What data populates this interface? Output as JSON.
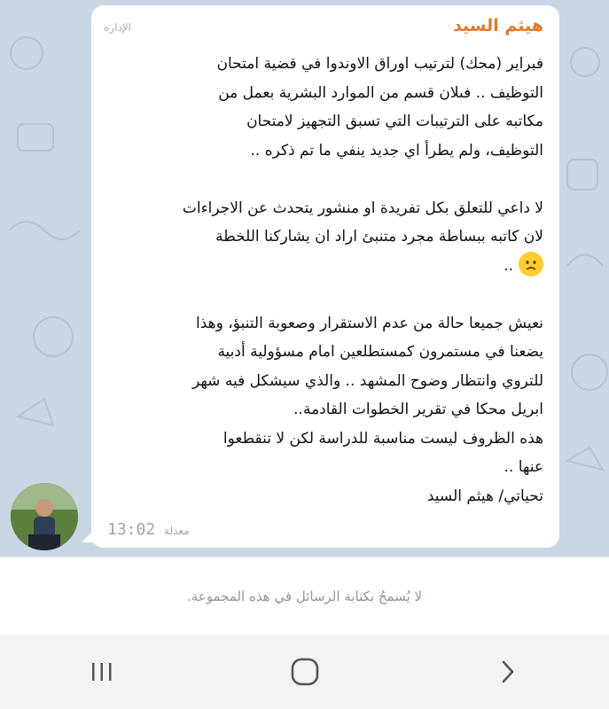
{
  "chat": {
    "message": {
      "sender_name": "هيثم السيد",
      "admin_badge": "الإدارة",
      "lines": [
        "فبراير  (محك)  لترتيب اوراق الاوندوا في قضية امتحان",
        "التوظيف .. فىلان قسم من الموارد البشرية بعمل من",
        "مكاتبه على الترتيبات التي تسبق التجهيز لامتحان",
        "التوظيف، ولم يطرأ اي جديد ينفي ما تم ذكره ..",
        "",
        "لا داعي للتعلق بكل تفريدة او منشور يتحدث عن الاجراءات",
        "لان كاتبه ببساطة مجرد متنبئ اراد ان يشاركنا اللخطة",
        "..",
        "",
        " نعيش جميعا حالة من عدم الاستقرار  وصعوبة التنبؤ، وهذا",
        "يضعنا في مستمرون كمستطلعين  امام مسؤولية أدبية",
        "للتروي وانتظار وضوح المشهد .. والذي سيشكل فيه شهر",
        "ابريل محكا في تقرير الخطوات القادمة..",
        "هذه الظروف ليست مناسبة للدراسة لكن لا تنقطعوا",
        "عنها ..",
        "تحياتي/ هيثم السيد"
      ],
      "edited_label": "معدلة",
      "time": "13:02",
      "emoji": "sad-face-emoji"
    }
  },
  "restriction_text": "لا يُسمحُ بكتابة الرسائل في هذه المجموعة.",
  "nav": {
    "recents_icon": "recents-icon",
    "home_icon": "home-icon",
    "back_icon": "back-icon"
  },
  "colors": {
    "chat_background": "#c9d6e3",
    "sender_name": "#e07a2e",
    "bubble": "#ffffff",
    "nav_bar": "#f3f3f5"
  }
}
